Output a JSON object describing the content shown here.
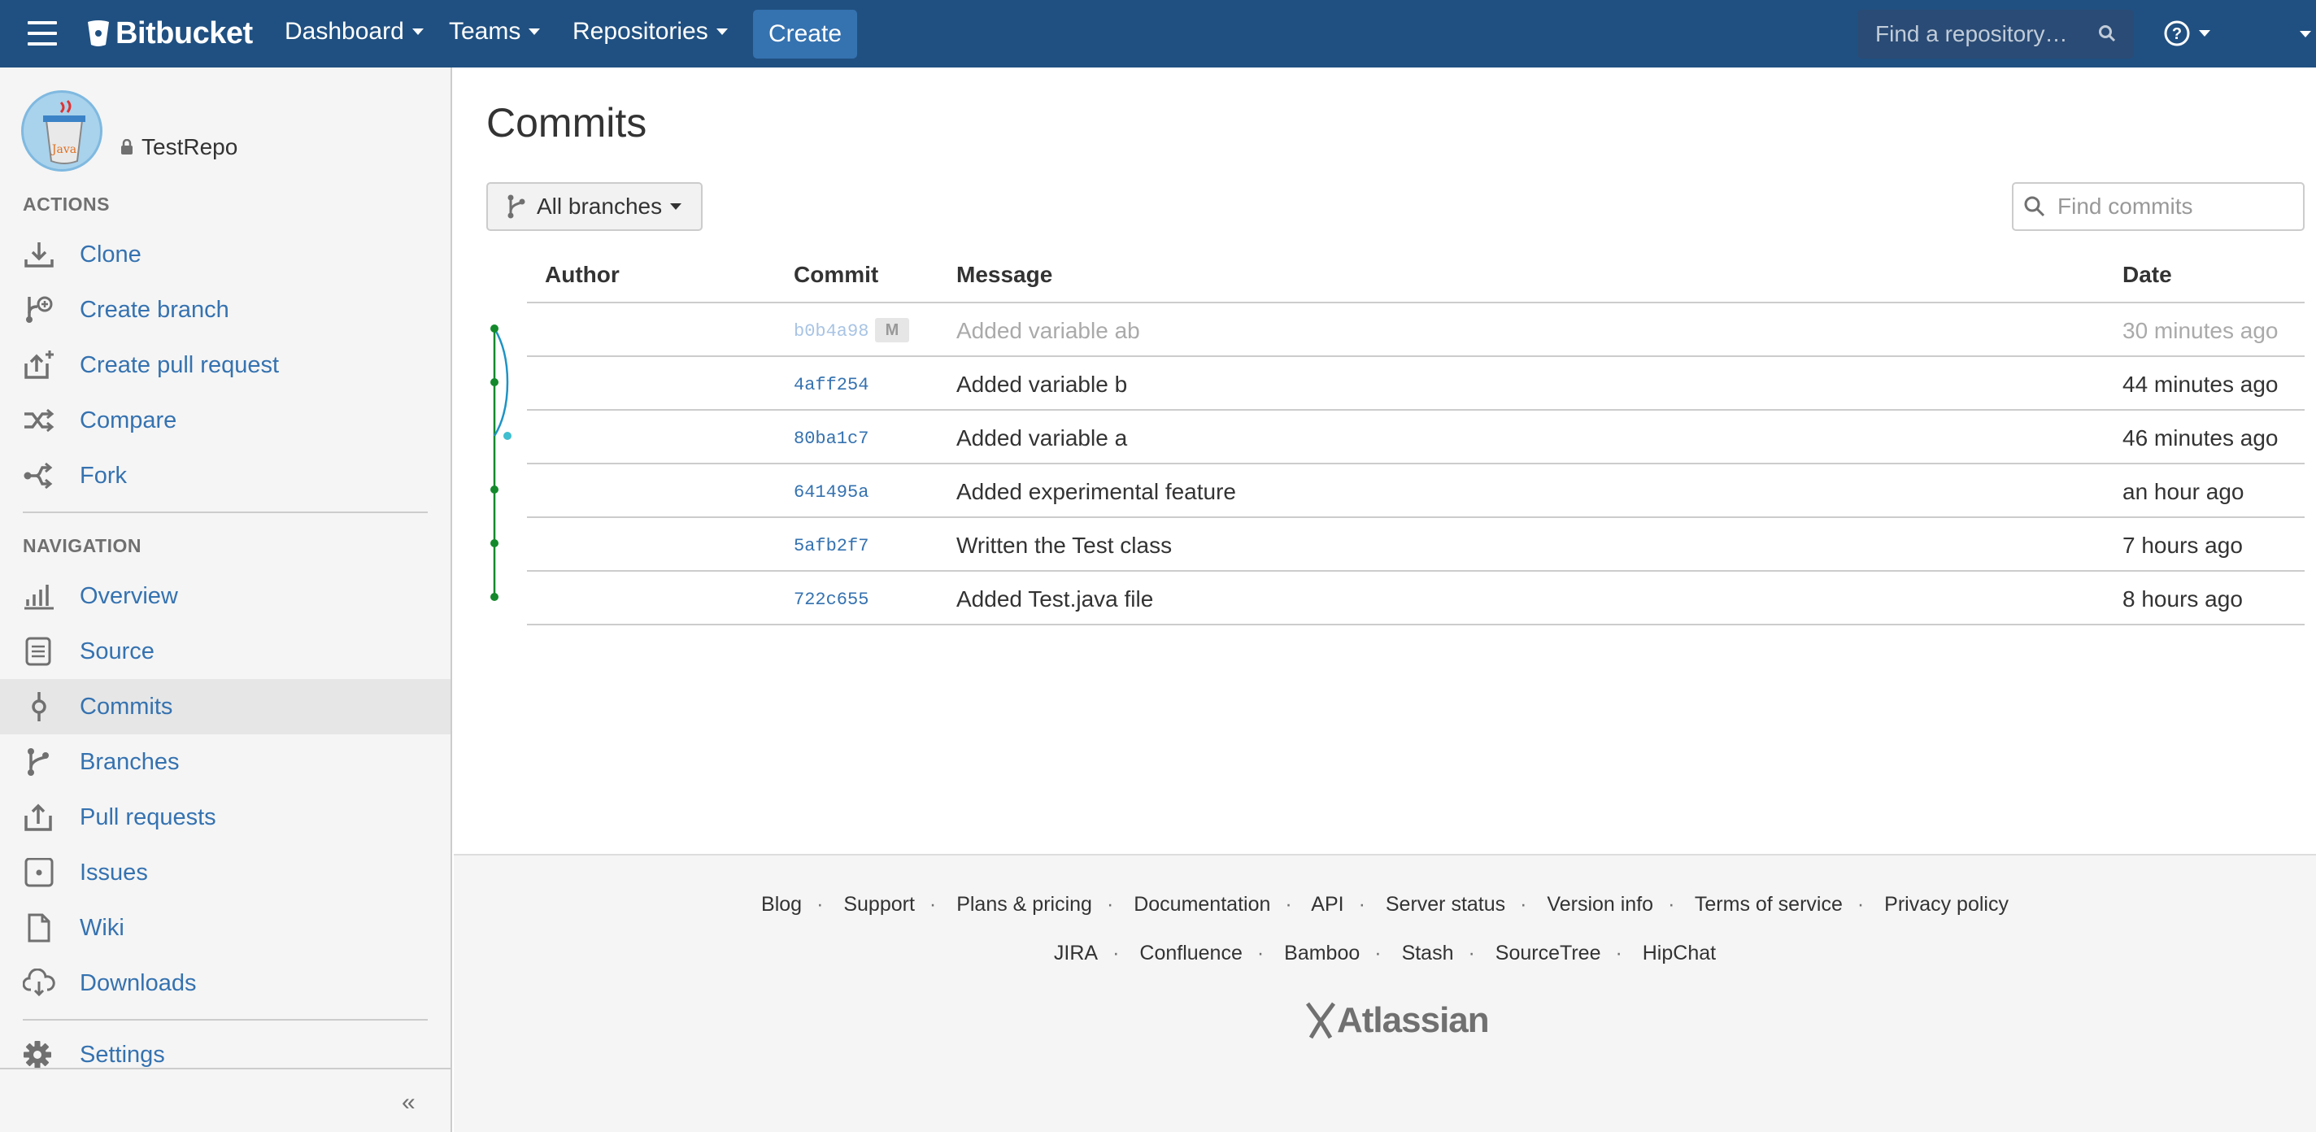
{
  "topbar": {
    "brand": "Bitbucket",
    "menus": [
      {
        "label": "Dashboard"
      },
      {
        "label": "Teams"
      },
      {
        "label": "Repositories"
      }
    ],
    "create_label": "Create",
    "search_placeholder": "Find a repository…",
    "colors": {
      "bar": "#205081",
      "create": "#3572b0"
    }
  },
  "sidebar": {
    "repo_name": "TestRepo",
    "avatar_text": "Java",
    "actions_heading": "ACTIONS",
    "actions": [
      {
        "label": "Clone",
        "icon": "download-icon"
      },
      {
        "label": "Create branch",
        "icon": "create-branch-icon"
      },
      {
        "label": "Create pull request",
        "icon": "create-pull-request-icon"
      },
      {
        "label": "Compare",
        "icon": "compare-icon"
      },
      {
        "label": "Fork",
        "icon": "fork-icon"
      }
    ],
    "navigation_heading": "NAVIGATION",
    "navigation": [
      {
        "label": "Overview",
        "icon": "overview-icon"
      },
      {
        "label": "Source",
        "icon": "source-icon"
      },
      {
        "label": "Commits",
        "icon": "commits-icon",
        "active": true
      },
      {
        "label": "Branches",
        "icon": "branches-icon"
      },
      {
        "label": "Pull requests",
        "icon": "pull-requests-icon"
      },
      {
        "label": "Issues",
        "icon": "issues-icon"
      },
      {
        "label": "Wiki",
        "icon": "wiki-icon"
      },
      {
        "label": "Downloads",
        "icon": "downloads-icon"
      }
    ],
    "settings_label": "Settings",
    "collapse_glyph": "«"
  },
  "main": {
    "title": "Commits",
    "branch_filter": "All branches",
    "find_placeholder": "Find commits",
    "columns": {
      "author": "Author",
      "commit": "Commit",
      "message": "Message",
      "date": "Date"
    },
    "commits": [
      {
        "hash": "b0b4a98",
        "badge": "M",
        "message": "Added variable ab",
        "date": "30 minutes ago",
        "merge": true
      },
      {
        "hash": "4aff254",
        "message": "Added variable b",
        "date": "44 minutes ago"
      },
      {
        "hash": "80ba1c7",
        "message": "Added variable a",
        "date": "46 minutes ago"
      },
      {
        "hash": "641495a",
        "message": "Added experimental feature",
        "date": "an hour ago"
      },
      {
        "hash": "5afb2f7",
        "message": "Written the Test class",
        "date": "7 hours ago"
      },
      {
        "hash": "722c655",
        "message": "Added Test.java file",
        "date": "8 hours ago"
      }
    ]
  },
  "footer": {
    "links_row1": [
      "Blog",
      "Support",
      "Plans & pricing",
      "Documentation",
      "API",
      "Server status",
      "Version info",
      "Terms of service",
      "Privacy policy"
    ],
    "links_row2": [
      "JIRA",
      "Confluence",
      "Bamboo",
      "Stash",
      "SourceTree",
      "HipChat"
    ],
    "brand": "Atlassian"
  }
}
